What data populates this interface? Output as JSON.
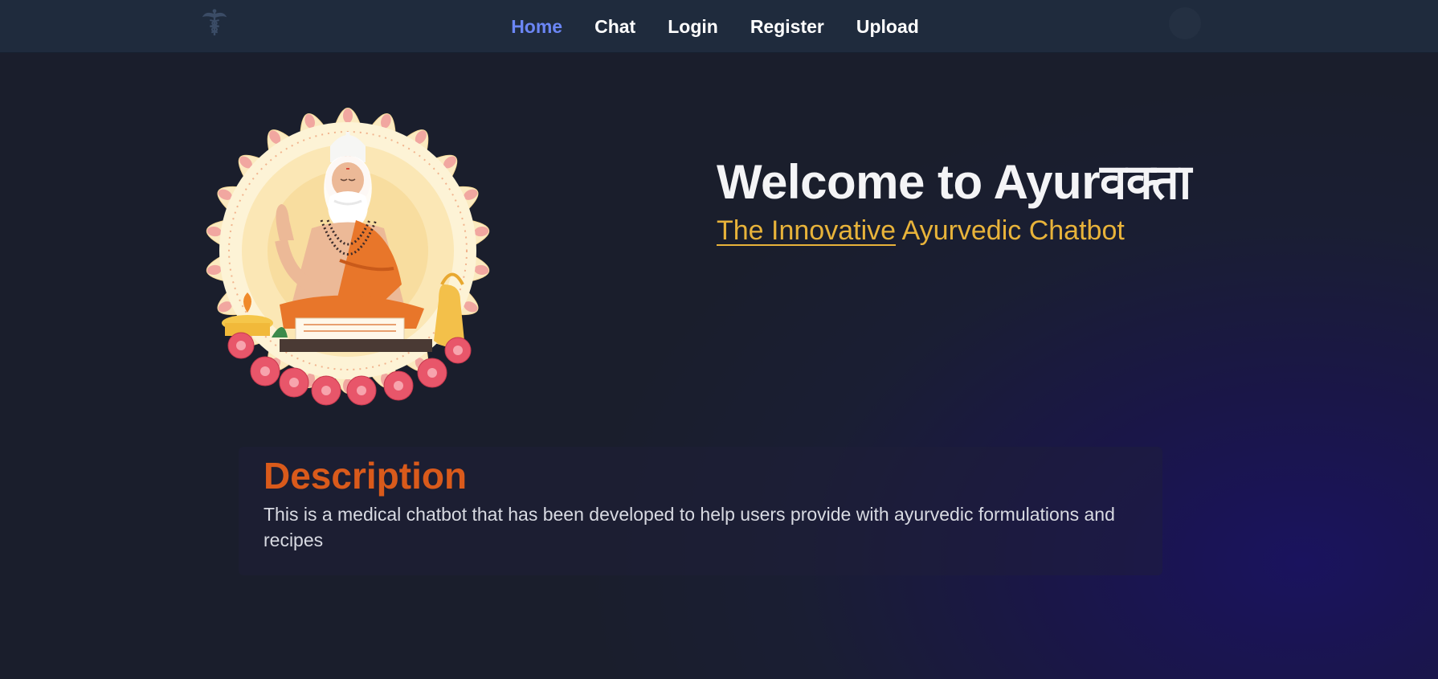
{
  "nav": {
    "items": [
      {
        "label": "Home",
        "active": true
      },
      {
        "label": "Chat"
      },
      {
        "label": "Login"
      },
      {
        "label": "Register"
      },
      {
        "label": "Upload"
      }
    ],
    "logo_icon": "caduceus-icon",
    "avatar_icon": "user-avatar"
  },
  "hero": {
    "title": "Welcome to Ayurवक्ता",
    "subtitle_underlined": "The Innovative",
    "subtitle_rest": " Ayurvedic Chatbot",
    "image_icon": "ayurveda-sage-illustration"
  },
  "description": {
    "title": "Description",
    "text": "This is a medical chatbot that has been developed to help users provide with ayurvedic formulations and recipes"
  },
  "colors": {
    "nav_active": "#6b86f5",
    "subtitle": "#e8b33a",
    "description_title": "#d95a1b",
    "nav_bg": "#1f2b3d",
    "page_bg": "#1a1e2c"
  }
}
